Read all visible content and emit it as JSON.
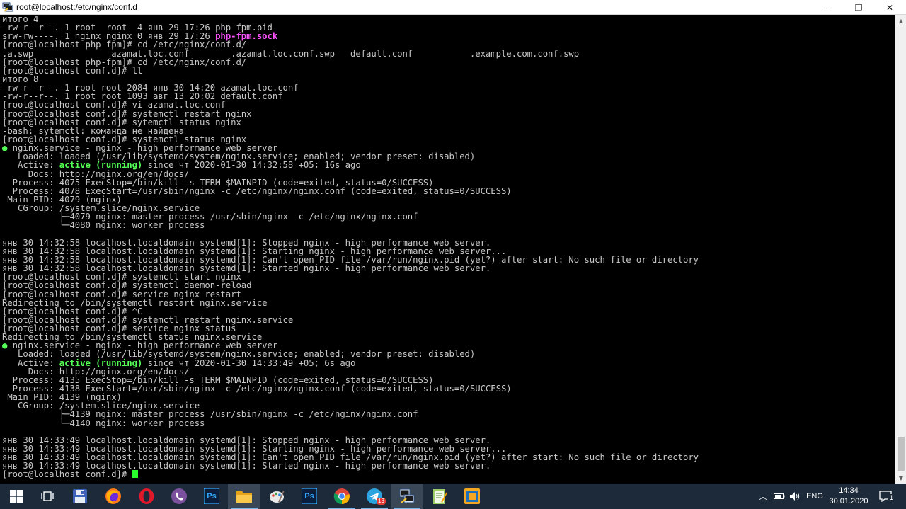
{
  "window": {
    "title": "root@localhost:/etc/nginx/conf.d",
    "minimize_glyph": "—",
    "maximize_glyph": "❐",
    "close_glyph": "✕"
  },
  "terminal": {
    "lines": [
      [
        {
          "t": "итого 4"
        }
      ],
      [
        {
          "t": "-rw-r--r--. 1 root  root  4 янв 29 17:26 php-fpm.pid"
        }
      ],
      [
        {
          "t": "srw-rw----. 1 nginx nginx 0 янв 29 17:26 "
        },
        {
          "t": "php-fpm.sock",
          "c": "magenta"
        }
      ],
      [
        {
          "t": "[root@localhost php-fpm]# cd /etc/nginx/conf.d/"
        }
      ],
      [
        {
          "t": ".a.swp               azamat.loc.conf        .azamat.loc.conf.swp   default.conf           .example.com.conf.swp"
        }
      ],
      [
        {
          "t": "[root@localhost php-fpm]# cd /etc/nginx/conf.d/"
        }
      ],
      [
        {
          "t": "[root@localhost conf.d]# ll"
        }
      ],
      [
        {
          "t": "итого 8"
        }
      ],
      [
        {
          "t": "-rw-r--r--. 1 root root 2084 янв 30 14:20 azamat.loc.conf"
        }
      ],
      [
        {
          "t": "-rw-r--r--. 1 root root 1093 авг 13 20:02 default.conf"
        }
      ],
      [
        {
          "t": "[root@localhost conf.d]# vi azamat.loc.conf"
        }
      ],
      [
        {
          "t": "[root@localhost conf.d]# systemctl restart nginx"
        }
      ],
      [
        {
          "t": "[root@localhost conf.d]# sytemctl status nginx"
        }
      ],
      [
        {
          "t": "-bash: sytemctl: команда не найдена"
        }
      ],
      [
        {
          "t": "[root@localhost conf.d]# systemctl status nginx"
        }
      ],
      [
        {
          "t": "●",
          "c": "dot"
        },
        {
          "t": " nginx.service - nginx - high performance web server"
        }
      ],
      [
        {
          "t": "   Loaded: loaded (/usr/lib/systemd/system/nginx.service; enabled; vendor preset: disabled)"
        }
      ],
      [
        {
          "t": "   Active: "
        },
        {
          "t": "active (running)",
          "c": "green"
        },
        {
          "t": " since чт 2020-01-30 14:32:58 +05; 16s ago"
        }
      ],
      [
        {
          "t": "     Docs: http://nginx.org/en/docs/"
        }
      ],
      [
        {
          "t": "  Process: 4075 ExecStop=/bin/kill -s TERM $MAINPID (code=exited, status=0/SUCCESS)"
        }
      ],
      [
        {
          "t": "  Process: 4078 ExecStart=/usr/sbin/nginx -c /etc/nginx/nginx.conf (code=exited, status=0/SUCCESS)"
        }
      ],
      [
        {
          "t": " Main PID: 4079 (nginx)"
        }
      ],
      [
        {
          "t": "   CGroup: /system.slice/nginx.service"
        }
      ],
      [
        {
          "t": "           ├─4079 nginx: master process /usr/sbin/nginx -c /etc/nginx/nginx.conf"
        }
      ],
      [
        {
          "t": "           └─4080 nginx: worker process"
        }
      ],
      [
        {
          "t": ""
        }
      ],
      [
        {
          "t": "янв 30 14:32:58 localhost.localdomain systemd[1]: Stopped nginx - high performance web server."
        }
      ],
      [
        {
          "t": "янв 30 14:32:58 localhost.localdomain systemd[1]: Starting nginx - high performance web server..."
        }
      ],
      [
        {
          "t": "янв 30 14:32:58 localhost.localdomain systemd[1]: Can't open PID file /var/run/nginx.pid (yet?) after start: No such file or directory"
        }
      ],
      [
        {
          "t": "янв 30 14:32:58 localhost.localdomain systemd[1]: Started nginx - high performance web server."
        }
      ],
      [
        {
          "t": "[root@localhost conf.d]# systemctl start nginx"
        }
      ],
      [
        {
          "t": "[root@localhost conf.d]# systemctl daemon-reload"
        }
      ],
      [
        {
          "t": "[root@localhost conf.d]# service nginx restart"
        }
      ],
      [
        {
          "t": "Redirecting to /bin/systemctl restart nginx.service"
        }
      ],
      [
        {
          "t": "[root@localhost conf.d]# ^C"
        }
      ],
      [
        {
          "t": "[root@localhost conf.d]# systemctl restart nginx.service"
        }
      ],
      [
        {
          "t": "[root@localhost conf.d]# service nginx status"
        }
      ],
      [
        {
          "t": "Redirecting to /bin/systemctl status nginx.service"
        }
      ],
      [
        {
          "t": "●",
          "c": "dot"
        },
        {
          "t": " nginx.service - nginx - high performance web server"
        }
      ],
      [
        {
          "t": "   Loaded: loaded (/usr/lib/systemd/system/nginx.service; enabled; vendor preset: disabled)"
        }
      ],
      [
        {
          "t": "   Active: "
        },
        {
          "t": "active (running)",
          "c": "green"
        },
        {
          "t": " since чт 2020-01-30 14:33:49 +05; 6s ago"
        }
      ],
      [
        {
          "t": "     Docs: http://nginx.org/en/docs/"
        }
      ],
      [
        {
          "t": "  Process: 4135 ExecStop=/bin/kill -s TERM $MAINPID (code=exited, status=0/SUCCESS)"
        }
      ],
      [
        {
          "t": "  Process: 4138 ExecStart=/usr/sbin/nginx -c /etc/nginx/nginx.conf (code=exited, status=0/SUCCESS)"
        }
      ],
      [
        {
          "t": " Main PID: 4139 (nginx)"
        }
      ],
      [
        {
          "t": "   CGroup: /system.slice/nginx.service"
        }
      ],
      [
        {
          "t": "           ├─4139 nginx: master process /usr/sbin/nginx -c /etc/nginx/nginx.conf"
        }
      ],
      [
        {
          "t": "           └─4140 nginx: worker process"
        }
      ],
      [
        {
          "t": ""
        }
      ],
      [
        {
          "t": "янв 30 14:33:49 localhost.localdomain systemd[1]: Stopped nginx - high performance web server."
        }
      ],
      [
        {
          "t": "янв 30 14:33:49 localhost.localdomain systemd[1]: Starting nginx - high performance web server..."
        }
      ],
      [
        {
          "t": "янв 30 14:33:49 localhost.localdomain systemd[1]: Can't open PID file /var/run/nginx.pid (yet?) after start: No such file or directory"
        }
      ],
      [
        {
          "t": "янв 30 14:33:49 localhost.localdomain systemd[1]: Started nginx - high performance web server."
        }
      ],
      [
        {
          "t": "[root@localhost conf.d]# "
        },
        {
          "t": "",
          "c": "cursor"
        }
      ]
    ],
    "colors": {
      "fg": "#c8c8c8",
      "bg": "#000000",
      "green": "#55ff55",
      "magenta": "#ff55ff",
      "cursor": "#2bff2b"
    }
  },
  "taskbar": {
    "items": [
      {
        "name": "start-button",
        "icon": "windows-logo-icon"
      },
      {
        "name": "task-view-button",
        "icon": "task-view-icon"
      },
      {
        "name": "taskbar-app-save",
        "icon": "floppy-disk-icon"
      },
      {
        "name": "taskbar-app-firefox",
        "icon": "firefox-icon"
      },
      {
        "name": "taskbar-app-opera",
        "icon": "opera-icon"
      },
      {
        "name": "taskbar-app-viber",
        "icon": "viber-icon"
      },
      {
        "name": "taskbar-app-photoshop-1",
        "icon": "photoshop-icon",
        "label": "Ps"
      },
      {
        "name": "taskbar-app-explorer",
        "icon": "folder-icon"
      },
      {
        "name": "taskbar-app-paint",
        "icon": "palette-icon"
      },
      {
        "name": "taskbar-app-photoshop-2",
        "icon": "photoshop-icon",
        "label": "Ps"
      },
      {
        "name": "taskbar-app-chrome",
        "icon": "chrome-icon"
      },
      {
        "name": "taskbar-app-telegram",
        "icon": "telegram-icon",
        "badge": "13"
      },
      {
        "name": "taskbar-app-putty",
        "icon": "putty-icon"
      },
      {
        "name": "taskbar-app-notepad",
        "icon": "notepad-icon"
      },
      {
        "name": "taskbar-app-filezilla",
        "icon": "filezilla-icon"
      }
    ],
    "tray": {
      "language": "ENG",
      "time": "14:34",
      "date": "30.01.2020",
      "notifications_badge": "1"
    }
  }
}
